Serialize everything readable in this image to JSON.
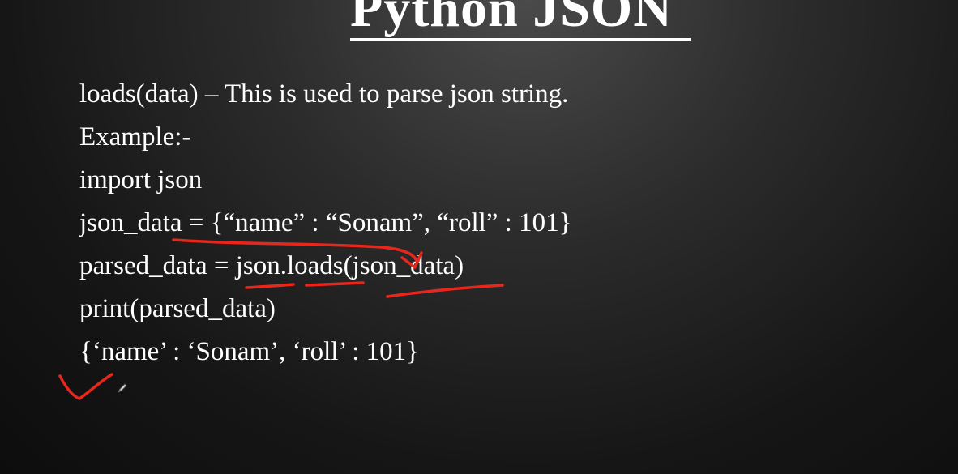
{
  "slide": {
    "title": "Python JSON",
    "lines": [
      "loads(data) – This is used to parse json string.",
      "Example:-",
      "import json",
      "json_data = {“name” : “Sonam”, “roll” : 101}",
      "parsed_data = json.loads(json_data)",
      "print(parsed_data)",
      "{‘name’ : ‘Sonam’, ‘roll’ : 101}"
    ]
  },
  "annotations": {
    "ink_color": "#e8261c"
  },
  "cursor": {
    "icon": "pen-cursor-icon"
  }
}
